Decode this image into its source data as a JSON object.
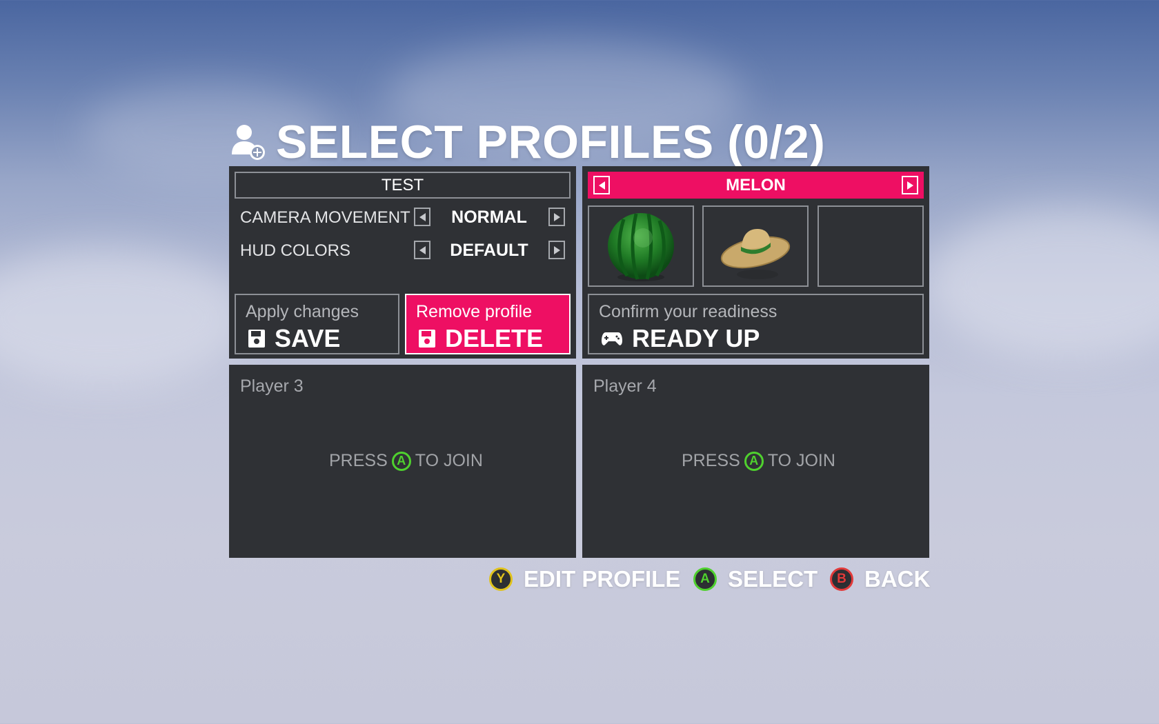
{
  "title": {
    "text": "SELECT PROFILES (0/2)",
    "icon": "add-user-icon"
  },
  "player1": {
    "profile_name": "TEST",
    "options": [
      {
        "label": "CAMERA MOVEMENT",
        "value": "NORMAL"
      },
      {
        "label": "HUD COLORS",
        "value": "DEFAULT"
      }
    ],
    "save": {
      "sub": "Apply changes",
      "label": "SAVE",
      "icon": "floppy-disk-icon"
    },
    "delete": {
      "sub": "Remove profile",
      "label": "DELETE",
      "icon": "floppy-disk-icon"
    }
  },
  "player2": {
    "profile_name": "MELON",
    "slots": [
      "watermelon-ball",
      "straw-hat",
      "empty"
    ],
    "ready": {
      "sub": "Confirm your readiness",
      "label": "READY UP",
      "icon": "gamepad-icon"
    }
  },
  "player3": {
    "title": "Player 3",
    "press": "PRESS",
    "button": "A",
    "join": "TO JOIN"
  },
  "player4": {
    "title": "Player 4",
    "press": "PRESS",
    "button": "A",
    "join": "TO JOIN"
  },
  "hints": [
    {
      "button": "Y",
      "label": "EDIT PROFILE",
      "color": "#e0c21c"
    },
    {
      "button": "A",
      "label": "SELECT",
      "color": "#4fd12e"
    },
    {
      "button": "B",
      "label": "BACK",
      "color": "#e23a3a"
    }
  ],
  "colors": {
    "accent": "#ee0f63",
    "panel": "#2f3135"
  }
}
